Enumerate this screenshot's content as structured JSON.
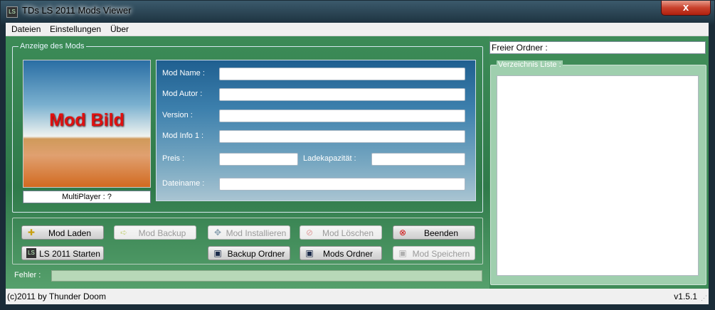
{
  "window": {
    "title": "TDs LS 2011 Mods Viewer",
    "close_glyph": "x"
  },
  "menu": [
    "Dateien",
    "Einstellungen",
    "Über"
  ],
  "mod_group": {
    "legend": "Anzeige des Mods",
    "image_text": "Mod Bild",
    "multiplayer": "MultiPlayer : ?",
    "labels": {
      "name": "Mod Name :",
      "author": "Mod Autor :",
      "version": "Version :",
      "info": "Mod Info 1 :",
      "price": "Preis :",
      "capacity": "Ladekapazität :",
      "filename": "Dateiname :"
    },
    "values": {
      "name": "",
      "author": "",
      "version": "",
      "info": "",
      "price": "",
      "capacity": "",
      "filename": ""
    }
  },
  "buttons": {
    "load": "Mod Laden",
    "backup": "Mod Backup",
    "install": "Mod Installieren",
    "delete": "Mod Löschen",
    "exit": "Beenden",
    "start": "LS 2011 Starten",
    "backup_folder": "Backup Ordner",
    "mods_folder": "Mods Ordner",
    "save": "Mod Speichern"
  },
  "error": {
    "label": "Fehler :",
    "value": ""
  },
  "right_panel": {
    "free_folder": "Freier Ordner :",
    "list_legend": "Verzeichnis Liste :"
  },
  "status": {
    "copyright": "(c)2011 by Thunder Doom",
    "version": "v1.5.1"
  },
  "colors": {
    "title_red": "#e01010",
    "close_red": "#c8412c"
  }
}
